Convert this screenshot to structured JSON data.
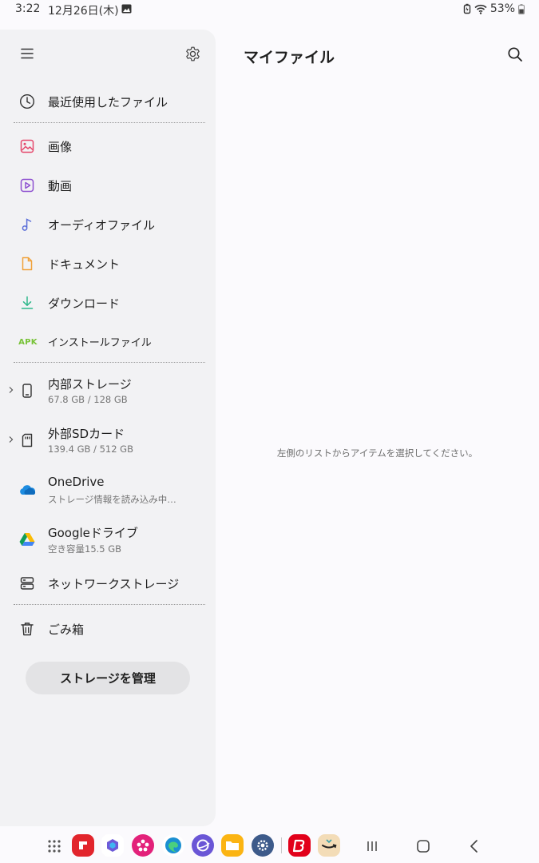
{
  "status": {
    "time": "3:22",
    "date": "12月26日(木)",
    "battery": "53%"
  },
  "drawer": {
    "recent": "最近使用したファイル",
    "categories": [
      {
        "label": "画像",
        "icon": "image-icon",
        "color": "#e5486c"
      },
      {
        "label": "動画",
        "icon": "video-icon",
        "color": "#8d4fd0"
      },
      {
        "label": "オーディオファイル",
        "icon": "music-icon",
        "color": "#5b6ed8"
      },
      {
        "label": "ドキュメント",
        "icon": "document-icon",
        "color": "#f0a23a"
      },
      {
        "label": "ダウンロード",
        "icon": "download-icon",
        "color": "#2fb88b"
      },
      {
        "label": "インストールファイル",
        "icon": "apk-icon",
        "badge": "APK",
        "color": "#77c236"
      }
    ],
    "storage": [
      {
        "label": "内部ストレージ",
        "sub": "67.8 GB / 128 GB",
        "icon": "phone-icon"
      },
      {
        "label": "外部SDカード",
        "sub": "139.4 GB / 512 GB",
        "icon": "sd-card-icon"
      },
      {
        "label": "OneDrive",
        "sub": "ストレージ情報を読み込み中…",
        "icon": "onedrive-icon"
      },
      {
        "label": "Googleドライブ",
        "sub": "空き容量15.5 GB",
        "icon": "google-drive-icon"
      },
      {
        "label": "ネットワークストレージ",
        "icon": "network-storage-icon"
      }
    ],
    "trash": "ごみ箱",
    "manage_button": "ストレージを管理"
  },
  "main": {
    "title": "マイファイル",
    "placeholder": "左側のリストからアイテムを選択してください。"
  },
  "dock": {
    "apps": [
      "flipboard-icon",
      "copilot-icon",
      "blossom-app-icon",
      "edge-icon",
      "internet-icon",
      "files-icon",
      "settings-app-icon",
      "bic-camera-icon",
      "amazon-icon"
    ]
  }
}
